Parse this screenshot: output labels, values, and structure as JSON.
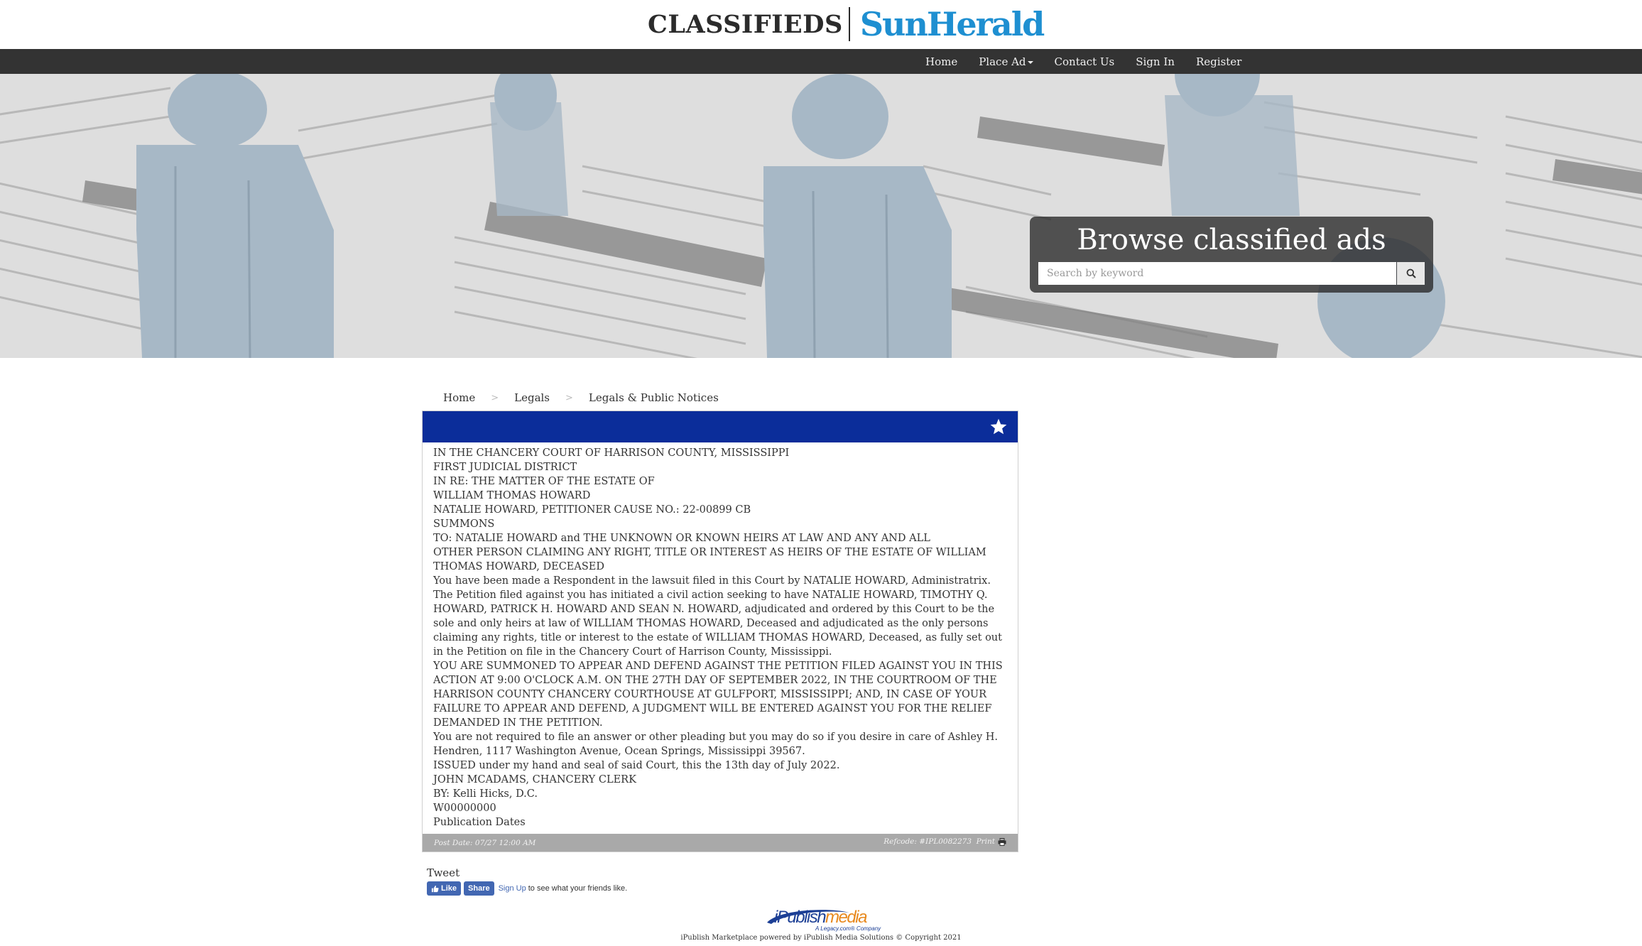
{
  "header": {
    "logo_classifieds": "CLASSIFIEDS",
    "logo_sunherald": "SunHerald"
  },
  "nav": {
    "items": [
      {
        "label": "Home"
      },
      {
        "label": "Place Ad"
      },
      {
        "label": "Contact Us"
      },
      {
        "label": "Sign In"
      },
      {
        "label": "Register"
      }
    ]
  },
  "hero": {
    "title": "Browse classified ads",
    "search_placeholder": "Search by keyword"
  },
  "breadcrumb": [
    "Home",
    "Legals",
    "Legals & Public Notices"
  ],
  "ad": {
    "lines": [
      "IN THE CHANCERY COURT OF HARRISON COUNTY, MISSISSIPPI",
      "FIRST JUDICIAL DISTRICT",
      "IN RE: THE MATTER OF THE ESTATE OF",
      "WILLIAM THOMAS HOWARD",
      "NATALIE HOWARD, PETITIONER CAUSE NO.: 22-00899 CB",
      "SUMMONS",
      "TO: NATALIE HOWARD and THE UNKNOWN OR KNOWN HEIRS AT LAW AND ANY AND ALL",
      "OTHER PERSON CLAIMING ANY RIGHT, TITLE OR INTEREST AS HEIRS OF THE ESTATE OF WILLIAM THOMAS HOWARD, DECEASED",
      "You have been made a Respondent in the lawsuit filed in this Court by NATALIE HOWARD, Administratrix.",
      "The Petition filed against you has initiated a civil action seeking to have NATALIE HOWARD, TIMOTHY Q. HOWARD, PATRICK H. HOWARD AND SEAN N. HOWARD, adjudicated and ordered by this Court to be the sole and only heirs at law of WILLIAM THOMAS HOWARD, Deceased and adjudicated as the only persons claiming any rights, title or interest to the estate of WILLIAM THOMAS HOWARD, Deceased, as fully set out in the Petition on file in the Chancery Court of Harrison County, Mississippi.",
      "YOU ARE SUMMONED TO APPEAR AND DEFEND AGAINST THE PETITION FILED AGAINST YOU IN THIS ACTION AT 9:00 O'CLOCK A.M. ON THE 27TH DAY OF SEPTEMBER 2022, IN THE COURTROOM OF THE HARRISON COUNTY CHANCERY COURTHOUSE AT GULFPORT, MISSISSIPPI; AND, IN CASE OF YOUR FAILURE TO APPEAR AND DEFEND, A JUDGMENT WILL BE ENTERED AGAINST YOU FOR THE RELIEF DEMANDED IN THE PETITION.",
      "You are not required to file an answer or other pleading but you may do so if you desire in care of Ashley H. Hendren, 1117 Washington Avenue, Ocean Springs, Mississippi 39567.",
      "ISSUED under my hand and seal of said Court, this the 13th day of July 2022.",
      "JOHN MCADAMS, CHANCERY CLERK",
      "BY: Kelli Hicks, D.C.",
      "W00000000",
      "Publication Dates"
    ],
    "post_date": "Post Date: 07/27 12:00 AM",
    "refcode": "Refcode: #IPL0082273",
    "print_label": "Print"
  },
  "social": {
    "tweet": "Tweet",
    "fb_like": "Like",
    "fb_share": "Share",
    "fb_signup": "Sign Up",
    "fb_text": "to see what your friends like."
  },
  "footer": {
    "logo_ipublish": "iPublish",
    "logo_media": "media",
    "logo_tagline": "A Legacy.com® Company",
    "copyright": "iPublish Marketplace powered by iPublish Media Solutions © Copyright 2021"
  },
  "colors": {
    "nav_bg": "#333333",
    "ad_header": "#0b2d9a",
    "brand_blue": "#1e8fd1"
  }
}
